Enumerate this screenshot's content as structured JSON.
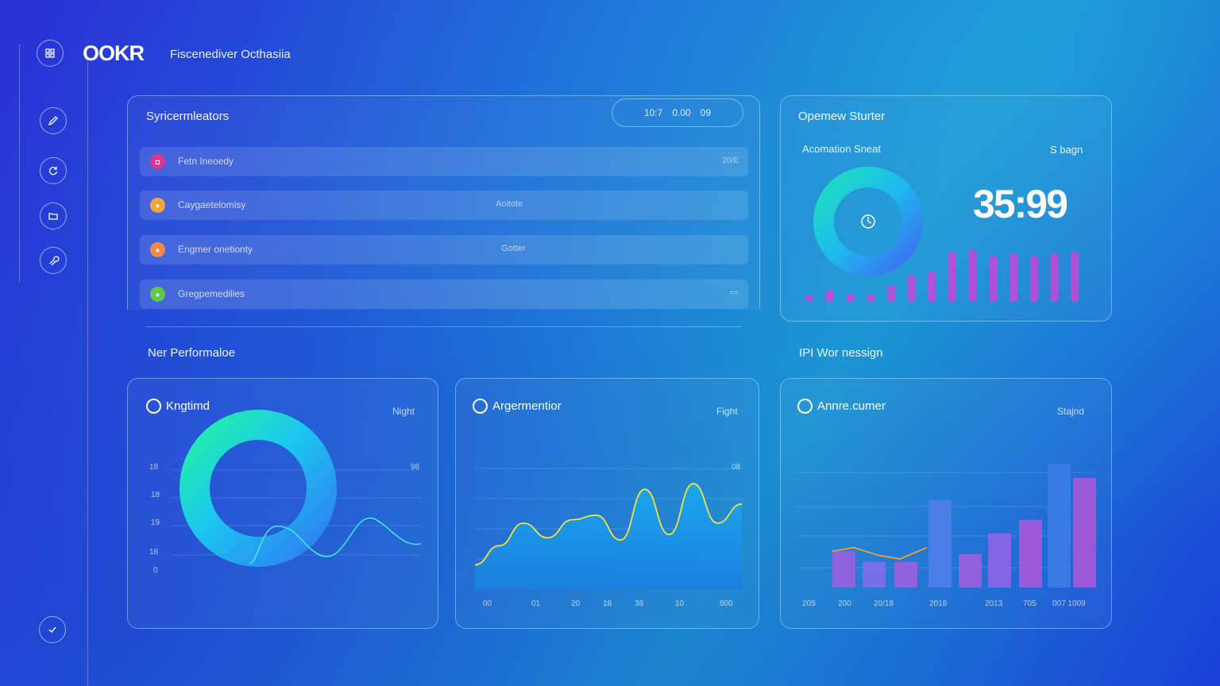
{
  "app": {
    "logo": "OOKR",
    "header_title": "Fiscenediver Octhasiia"
  },
  "sidebar": {
    "items": [
      {
        "icon": "grid-icon"
      },
      {
        "icon": "pencil-icon"
      },
      {
        "icon": "refresh-icon"
      },
      {
        "icon": "folder-icon"
      },
      {
        "icon": "wrench-icon"
      },
      {
        "icon": "check-icon"
      }
    ]
  },
  "top_panel": {
    "title": "Syricermleators",
    "time": [
      "10:7",
      "0.00",
      "09"
    ],
    "rows": [
      {
        "label": "Fetn Ineoedy",
        "mid": "",
        "end": "20/E",
        "color": "#e0338f",
        "icon": "◘"
      },
      {
        "label": "Caygaetelomlsy",
        "mid": "Aoitote",
        "end": "",
        "color": "#f3a63a",
        "icon": "●"
      },
      {
        "label": "Engmer onetionty",
        "mid": "Gotter",
        "end": "",
        "color": "#f2884a",
        "icon": "●"
      },
      {
        "label": "Gregpemedilies",
        "mid": "",
        "end": "==",
        "color": "#62c84a",
        "icon": "●"
      }
    ]
  },
  "overview": {
    "title": "Opemew Sturter",
    "label_left": "Acomation Sneat",
    "label_right": "S bagn",
    "big_number": "35:99",
    "bars": [
      0.08,
      0.18,
      0.12,
      0.12,
      0.25,
      0.42,
      0.48,
      0.78,
      0.82,
      0.72,
      0.75,
      0.72,
      0.75,
      0.78
    ]
  },
  "sections": {
    "left_title": "Ner Performaloe",
    "right_title": "IPI Wor nessign"
  },
  "cards": [
    {
      "title": "Kngtimd",
      "sub": "Night",
      "y_ticks": [
        "18",
        "18",
        "19",
        "18",
        "0"
      ],
      "right_tick": "98"
    },
    {
      "title": "Argermentior",
      "sub": "Fight",
      "right_tick": "08",
      "x_ticks": [
        "00",
        "01",
        "20",
        "18",
        "38",
        "10",
        "800"
      ],
      "series": [
        0.18,
        0.35,
        0.55,
        0.42,
        0.58,
        0.62,
        0.4,
        0.85,
        0.45,
        0.9,
        0.55,
        0.72
      ]
    },
    {
      "title": "Annre.cumer",
      "sub": "Stajnd",
      "x_ticks": [
        "205",
        "200",
        "20/18",
        "2018",
        "2013",
        "705",
        "007 1009"
      ],
      "bars": [
        0.38,
        0.27,
        0.27,
        0.92,
        0.35,
        0.57,
        0.71,
        1.3,
        1.15
      ],
      "line": [
        0.38,
        0.42,
        0.34,
        0.3,
        0.42
      ]
    }
  ],
  "colors": {
    "accent_purple": "#b04fd8",
    "accent_blue": "#3c7de6",
    "accent_yellow": "#f3e23a",
    "accent_teal": "#1de0c0"
  }
}
